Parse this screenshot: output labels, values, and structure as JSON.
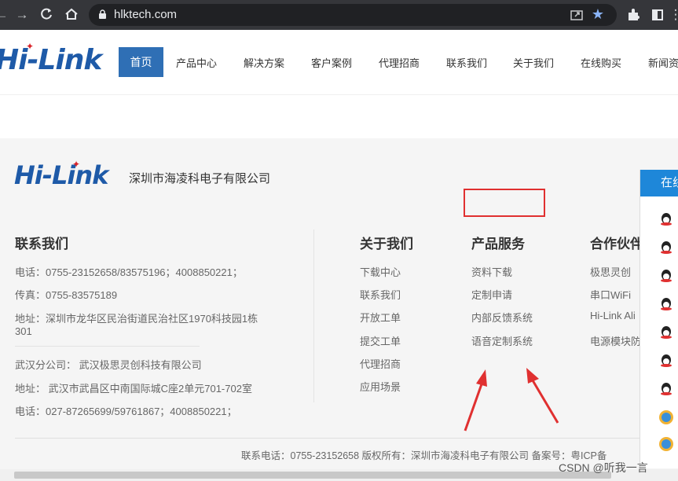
{
  "browser": {
    "url": "hlktech.com"
  },
  "header": {
    "logo_text": "Hi-Link",
    "nav": [
      "首页",
      "产品中心",
      "解决方案",
      "客户案例",
      "代理招商",
      "联系我们",
      "关于我们",
      "在线购买",
      "新闻资"
    ]
  },
  "footer": {
    "logo_text": "Hi-Link",
    "company_name": "深圳市海凌科电子有限公司",
    "contact": {
      "title": "联系我们",
      "lines": [
        "电话：0755-23152658/83575196；4008850221；",
        "传真：0755-83575189",
        "地址：深圳市龙华区民治街道民治社区1970科技园1栋",
        "301",
        "武汉分公司：  武汉极思灵创科技有限公司",
        "地址：  武汉市武昌区中南国际城C座2单元701-702室",
        "电话：027-87265699/59761867；4008850221；"
      ]
    },
    "about": {
      "title": "关于我们",
      "links": [
        "下载中心",
        "联系我们",
        "开放工单",
        "提交工单",
        "代理招商",
        "应用场景"
      ]
    },
    "products": {
      "title": "产品服务",
      "links": [
        "资料下载",
        "定制申请",
        "内部反馈系统",
        "语音定制系统"
      ]
    },
    "partners": {
      "title": "合作伙伴",
      "links": [
        "极思灵创",
        "串口WiFi",
        "Hi-Link Ali",
        "电源模块防"
      ]
    },
    "copyright": "联系电话：0755-23152658 版权所有：深圳市海凌科电子有限公司 备案号：粤ICP备"
  },
  "side_panel": {
    "header": "在线"
  },
  "watermark": "CSDN @听我一言",
  "colors": {
    "brand_blue": "#2f6fb5",
    "highlight_red": "#e03030"
  }
}
